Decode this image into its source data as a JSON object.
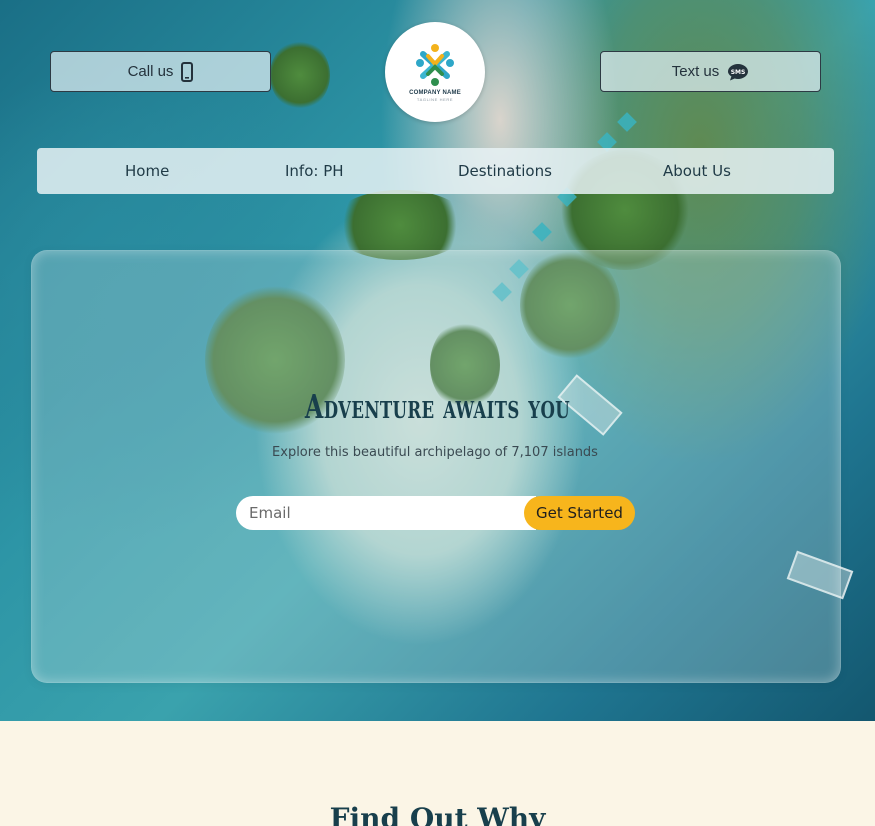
{
  "header": {
    "call_label": "Call us",
    "text_label": "Text us",
    "logo": {
      "name": "COMPANY NAME",
      "tagline": "TAGLINE HERE"
    }
  },
  "nav": {
    "items": [
      {
        "label": "Home"
      },
      {
        "label": "Info: PH"
      },
      {
        "label": "Destinations"
      },
      {
        "label": "About Us"
      }
    ]
  },
  "hero": {
    "headline": "Adventure awaits you",
    "subheadline": "Explore this beautiful archipelago of 7,107 islands",
    "email_placeholder": "Email",
    "cta_label": "Get Started"
  },
  "section": {
    "title": "Find Out Why"
  },
  "icons": {
    "call": "phone-icon",
    "text": "sms-icon",
    "logo": "people-logo-icon"
  },
  "colors": {
    "accent": "#f7b51c",
    "heading": "#183f4c",
    "section_bg": "#fbf5e6"
  }
}
